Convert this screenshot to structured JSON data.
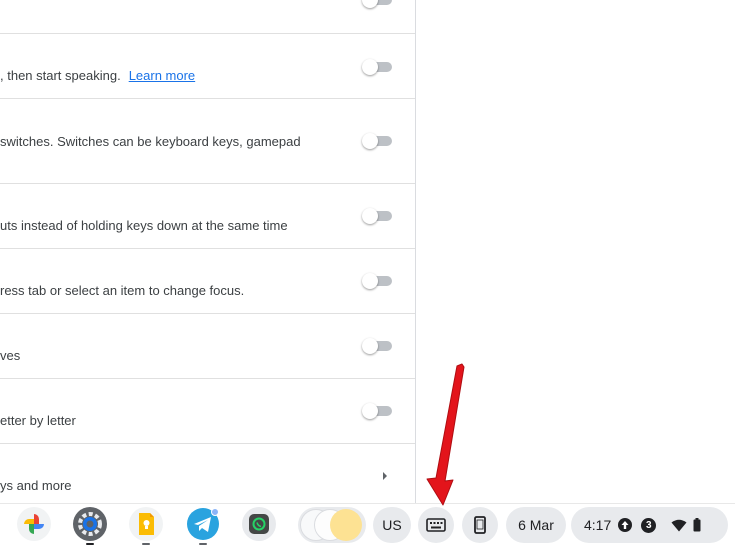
{
  "settings": {
    "partial_row_text": "",
    "rows": [
      {
        "text": ", then start speaking.",
        "link": "Learn more",
        "control": "toggle",
        "state": false
      },
      {
        "text": " switches. Switches can be keyboard keys, gamepad",
        "control": "toggle",
        "state": false
      },
      {
        "text": "uts instead of holding keys down at the same time",
        "control": "toggle",
        "state": false
      },
      {
        "text": "ress tab or select an item to change focus.",
        "control": "toggle",
        "state": false
      },
      {
        "text": "ves",
        "control": "toggle",
        "state": false
      },
      {
        "text": "etter by letter",
        "control": "toggle",
        "state": false
      },
      {
        "text": "ys and more",
        "control": "chevron"
      }
    ]
  },
  "shelf": {
    "apps": [
      "photos-icon",
      "settings-icon",
      "keep-icon",
      "telegram-icon",
      "whatsapp-icon"
    ],
    "ime_label": "US",
    "date_label": "6 Mar",
    "time_label": "4:17",
    "notification_count": "3"
  },
  "colors": {
    "link": "#1a73e8",
    "annotation_arrow": "#e3141b",
    "pill_bg": "#e8eaed"
  }
}
